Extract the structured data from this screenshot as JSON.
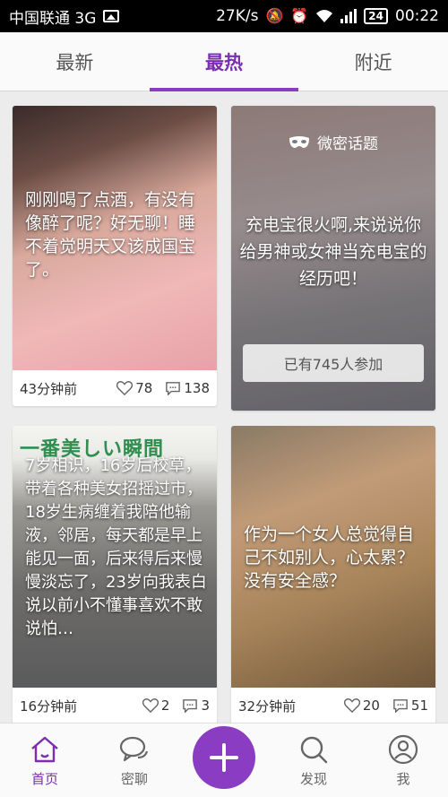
{
  "status_bar": {
    "carrier": "中国联通 3G",
    "speed": "27K/s",
    "battery": "24",
    "time": "00:22"
  },
  "tabs": [
    {
      "label": "最新",
      "active": false
    },
    {
      "label": "最热",
      "active": true
    },
    {
      "label": "附近",
      "active": false
    }
  ],
  "cards": [
    {
      "caption": "刚刚喝了点酒，有没有像醉了呢？好无聊！睡不着觉明天又该成国宝了。",
      "time": "43分钟前",
      "likes": "78",
      "comments": "138"
    },
    {
      "topic_label": "微密话题",
      "caption": "充电宝很火啊,来说说你给男神或女神当充电宝的经历吧！",
      "join_text": "已有745人参加"
    },
    {
      "photo_title": "一番美しい瞬間",
      "caption": "7岁相识，16岁后校草，带着各种美女招摇过市，18岁生病缠着我陪他输液，邻居，每天都是早上能见一面，后来得后来慢慢淡忘了，23岁向我表白说以前小不懂事喜欢不敢说怕…",
      "time": "16分钟前",
      "likes": "2",
      "comments": "3"
    },
    {
      "caption": "作为一个女人总觉得自己不如别人，心太累？没有安全感？",
      "time": "32分钟前",
      "likes": "20",
      "comments": "51"
    }
  ],
  "bottom_nav": [
    {
      "label": "首页",
      "icon": "home-icon",
      "active": true
    },
    {
      "label": "密聊",
      "icon": "chat-icon",
      "active": false
    },
    {
      "label": "发现",
      "icon": "search-icon",
      "active": false
    },
    {
      "label": "我",
      "icon": "profile-icon",
      "active": false
    }
  ],
  "colors": {
    "accent": "#8a3cc2",
    "status_bar": "#000000",
    "background": "#ececec"
  }
}
